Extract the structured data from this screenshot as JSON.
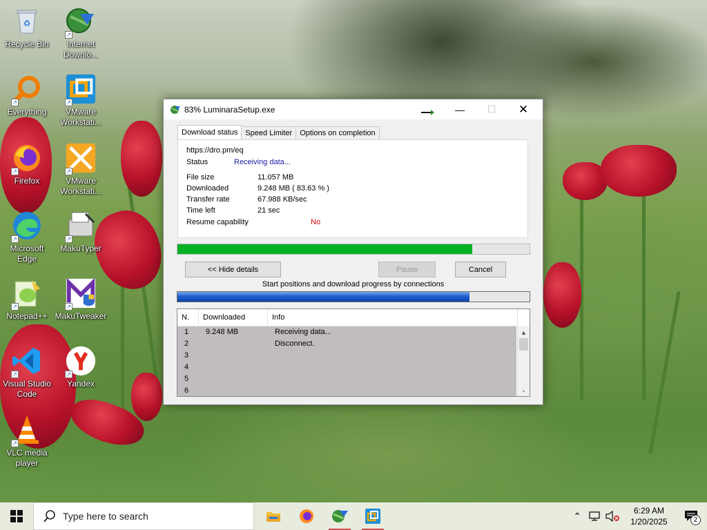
{
  "desktop": {
    "icons": [
      {
        "label": "Recycle Bin"
      },
      {
        "label": "Internet Downlo..."
      },
      {
        "label": "Everything"
      },
      {
        "label": "VMware Workstati..."
      },
      {
        "label": "Firefox"
      },
      {
        "label": "VMware Workstati..."
      },
      {
        "label": "Microsoft Edge"
      },
      {
        "label": "MakuTyper"
      },
      {
        "label": "Notepad++"
      },
      {
        "label": "MakuTweaker"
      },
      {
        "label": "Visual Studio Code"
      },
      {
        "label": "Yandex"
      },
      {
        "label": "VLC media player"
      }
    ]
  },
  "window": {
    "title": "83% LuminaraSetup.exe",
    "tabs": [
      "Download status",
      "Speed Limiter",
      "Options on completion"
    ],
    "url": "https://dro.pm/eq",
    "status_label": "Status",
    "status_value": "Receiving data...",
    "status_color": "#1a1aa6",
    "file_size_label": "File size",
    "file_size_value": "11.057  MB",
    "downloaded_label": "Downloaded",
    "downloaded_value": "9.248  MB  ( 83.63 % )",
    "transfer_rate_label": "Transfer rate",
    "transfer_rate_value": "67.988  KB/sec",
    "time_left_label": "Time left",
    "time_left_value": "21 sec",
    "resume_label": "Resume capability",
    "resume_value": "No",
    "resume_color": "#d40000",
    "progress_fraction": 0.8363,
    "hide_details_label": "<< Hide details",
    "pause_label": "Pause",
    "cancel_label": "Cancel",
    "connections_caption": "Start positions and download progress by connections",
    "connections_fraction": 0.83,
    "table": {
      "columns": [
        "N.",
        "Downloaded",
        "Info"
      ],
      "rows": [
        [
          "1",
          "9.248  MB",
          "Receiving data..."
        ],
        [
          "2",
          "",
          "Disconnect."
        ],
        [
          "3",
          "",
          ""
        ],
        [
          "4",
          "",
          ""
        ],
        [
          "5",
          "",
          ""
        ],
        [
          "6",
          "",
          ""
        ]
      ]
    }
  },
  "taskbar": {
    "search_placeholder": "Type here to search",
    "time": "6:29 AM",
    "date": "1/20/2025",
    "notifications_count": "2"
  }
}
